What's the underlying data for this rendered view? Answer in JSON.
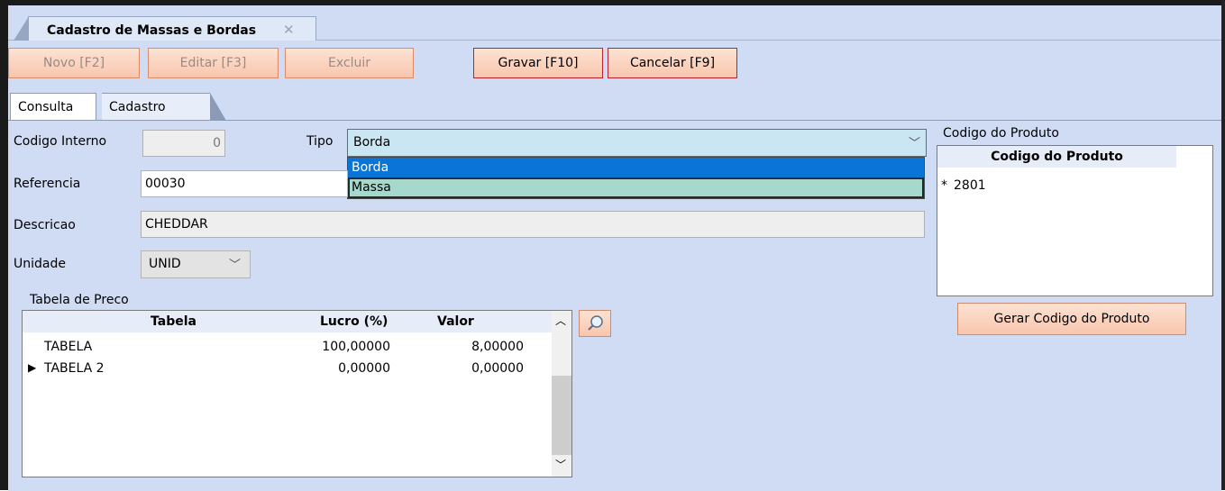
{
  "window": {
    "doc_tab_title": "Cadastro de Massas e Bordas",
    "close_icon": "close-icon"
  },
  "toolbar": {
    "novo": "Novo [F2]",
    "editar": "Editar [F3]",
    "excluir": "Excluir",
    "gravar": "Gravar [F10]",
    "cancelar": "Cancelar [F9]"
  },
  "tabs": {
    "consulta": "Consulta",
    "cadastro": "Cadastro"
  },
  "form": {
    "codigo_interno_label": "Codigo Interno",
    "codigo_interno_value": "0",
    "tipo_label": "Tipo",
    "tipo_value": "Borda",
    "tipo_options": [
      "Borda",
      "Massa"
    ],
    "referencia_label": "Referencia",
    "referencia_value": "00030",
    "descricao_label": "Descricao",
    "descricao_value": "CHEDDAR",
    "unidade_label": "Unidade",
    "unidade_value": "UNID"
  },
  "price_table": {
    "group_label": "Tabela de Preco",
    "columns": [
      "Tabela",
      "Lucro (%)",
      "Valor"
    ],
    "rows": [
      {
        "tabela": "TABELA",
        "lucro": "100,00000",
        "valor": "8,00000"
      },
      {
        "tabela": "TABELA 2",
        "lucro": "0,00000",
        "valor": "0,00000"
      }
    ]
  },
  "product_code": {
    "group_label": "Codigo do Produto",
    "column": "Codigo do Produto",
    "rows": [
      {
        "marker": "*",
        "value": "2801"
      }
    ],
    "generate_button": "Gerar Codigo do Produto"
  },
  "colors": {
    "background": "#cfdcf3",
    "button_fill": "#f8c6ad",
    "selection": "#0b74d7",
    "alt_item": "#a6d9cb"
  }
}
